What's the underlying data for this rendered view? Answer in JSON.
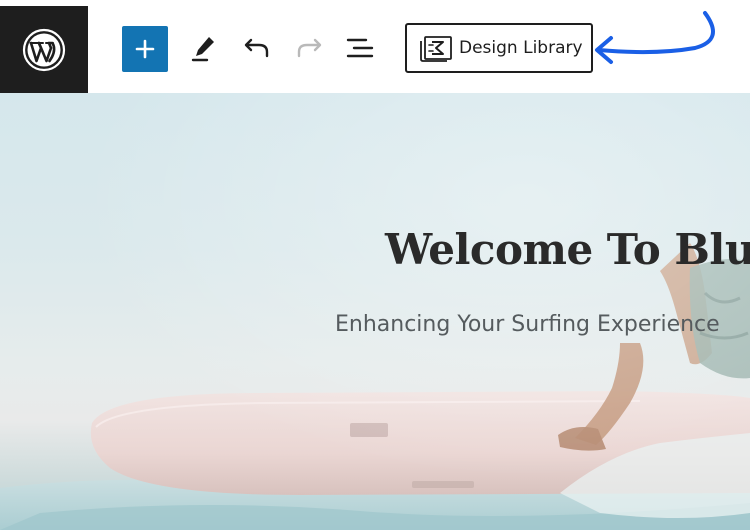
{
  "toolbar": {
    "logo_icon": "wordpress-logo-icon",
    "add_icon": "plus-icon",
    "edit_icon": "pencil-icon",
    "undo_icon": "undo-icon",
    "redo_icon": "redo-icon",
    "list_view_icon": "list-view-icon",
    "design_library": {
      "label": "Design Library",
      "icon": "design-library-icon"
    },
    "accent_color": "#1374b3",
    "annotation_color": "#1a5fe6"
  },
  "hero": {
    "title": "Welcome To BlueV",
    "subtitle": "Enhancing Your Surfing Experience"
  }
}
